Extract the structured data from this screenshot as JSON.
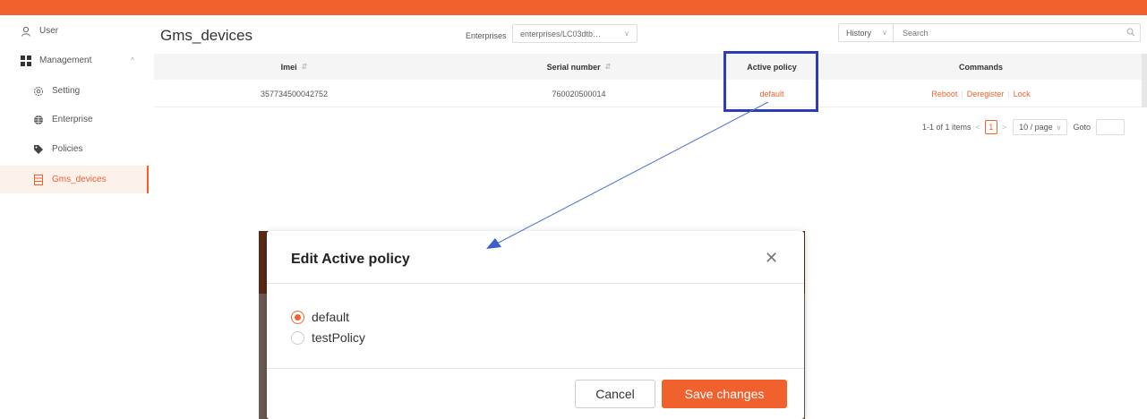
{
  "colors": {
    "accent": "#f0612d",
    "highlight": "#2e3db5",
    "arrow": "#4a6fd0"
  },
  "sidebar": {
    "user": {
      "label": "User",
      "icon": "user-icon"
    },
    "management": {
      "label": "Management",
      "icon": "grid-icon"
    },
    "items": [
      {
        "label": "Setting",
        "icon": "gear-icon"
      },
      {
        "label": "Enterprise",
        "icon": "globe-icon"
      },
      {
        "label": "Policies",
        "icon": "tag-icon"
      },
      {
        "label": "Gms_devices",
        "icon": "device-list-icon",
        "active": true
      }
    ]
  },
  "header": {
    "title": "Gms_devices",
    "enterprises_label": "Enterprises",
    "enterprises_value": "enterprises/LC03dtb…",
    "history_label": "History",
    "search_placeholder": "Search"
  },
  "table": {
    "columns": [
      "Imei",
      "Serial number",
      "Active policy",
      "Commands"
    ],
    "rows": [
      {
        "imei": "357734500042752",
        "serial": "760020500014",
        "policy": "default",
        "commands": [
          "Reboot",
          "Deregister",
          "Lock"
        ]
      }
    ]
  },
  "pagination": {
    "summary": "1-1 of 1 items",
    "current_page": "1",
    "page_size": "10 / page",
    "goto_label": "Goto"
  },
  "modal": {
    "title": "Edit Active policy",
    "options": [
      {
        "label": "default",
        "selected": true
      },
      {
        "label": "testPolicy",
        "selected": false
      }
    ],
    "cancel_label": "Cancel",
    "save_label": "Save changes"
  }
}
